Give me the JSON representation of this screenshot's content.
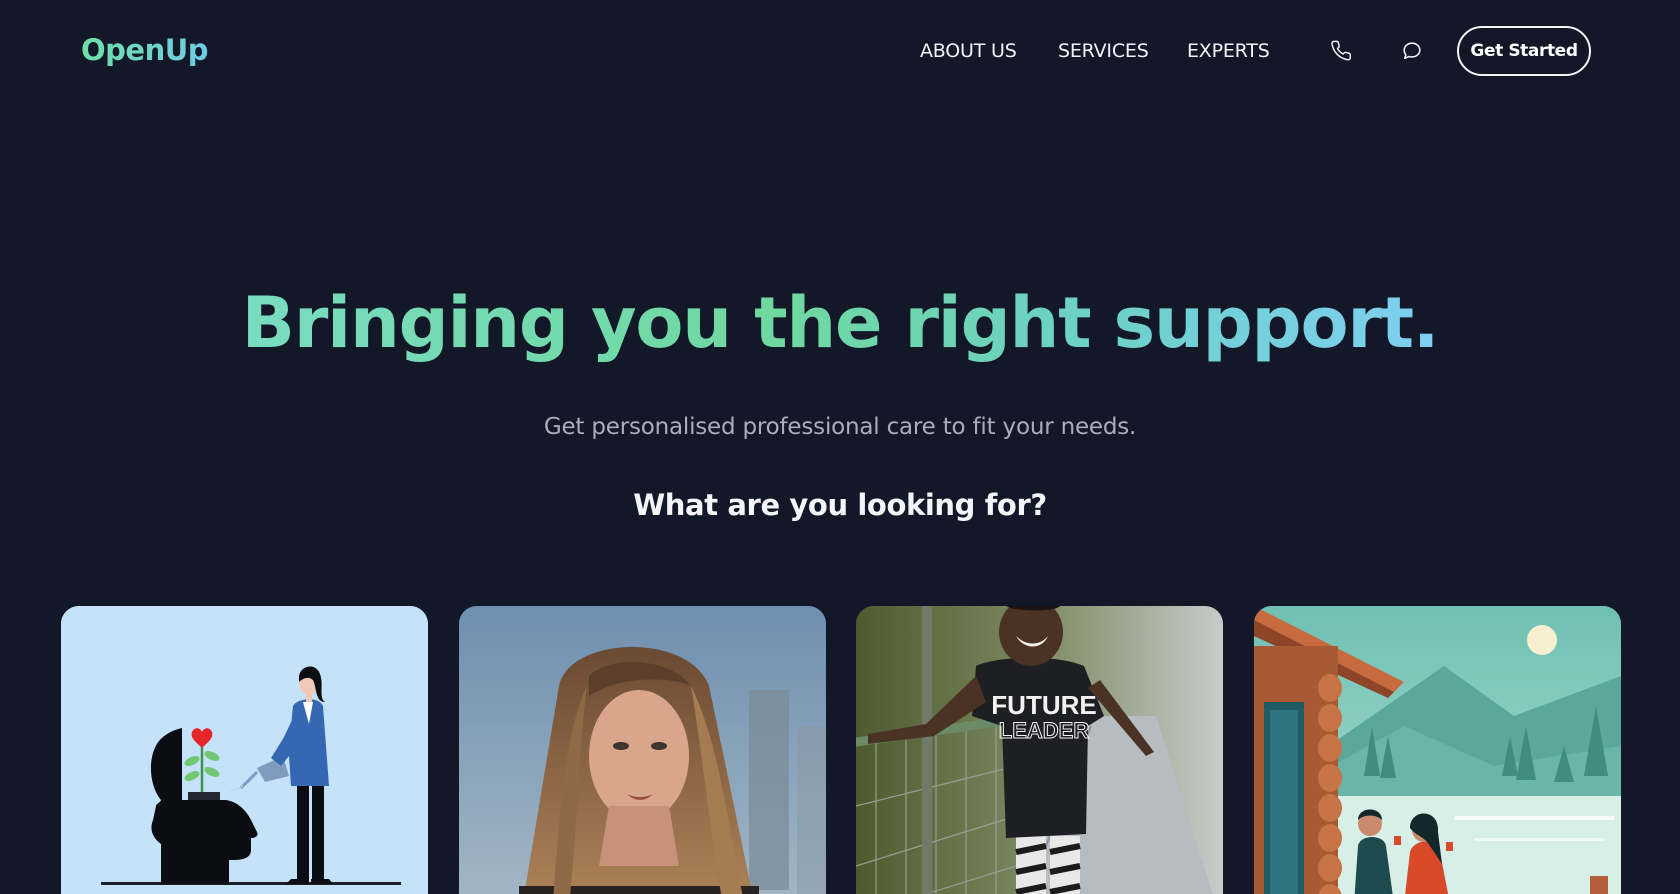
{
  "brand": {
    "name": "OpenUp"
  },
  "nav": {
    "links": [
      "ABOUT US",
      "SERVICES",
      "EXPERTS"
    ],
    "icons": [
      "phone-icon",
      "chat-icon"
    ],
    "cta_label": "Get Started"
  },
  "hero": {
    "title": "Bringing you the right support.",
    "subtitle": "Get personalised professional care to fit your needs.",
    "question": "What are you looking for?"
  },
  "cards": [
    {
      "image": "illustration-woman-watering-plant-in-head"
    },
    {
      "image": "photo-young-woman-portrait"
    },
    {
      "image": "photo-child-future-leader-shirt",
      "shirt_text": [
        "FUTURE",
        "LEADER"
      ]
    },
    {
      "image": "illustration-couple-by-lake-cabin"
    }
  ],
  "colors": {
    "background": "#131829",
    "gradient_green": "#6fd89f",
    "gradient_blue": "#7fcff2",
    "text": "#f1f3f8",
    "muted": "#a9aeb9"
  }
}
